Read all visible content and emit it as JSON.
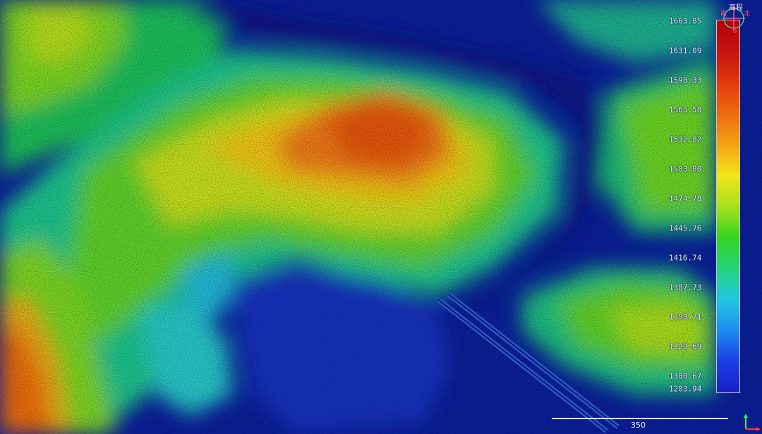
{
  "map": {
    "legend": {
      "ticks": [
        "1663.85",
        "1631.09",
        "1598.33",
        "1565.58",
        "1532.82",
        "1503.80",
        "1474.78",
        "1445.76",
        "1416.74",
        "1387.73",
        "1358.71",
        "1329.69",
        "1300.67",
        "1283.94"
      ],
      "colors": [
        "#1a1fc8",
        "#1a3ee6",
        "#1c8ef0",
        "#21c7e3",
        "#22d47a",
        "#34d421",
        "#a8e01d",
        "#f2e617",
        "#f2a313",
        "#ef6a10",
        "#e23a0c",
        "#c51410",
        "#b4000a"
      ]
    },
    "compass": {
      "label": "高程",
      "icon": "compass-icon"
    },
    "scale": {
      "label": "350"
    }
  }
}
